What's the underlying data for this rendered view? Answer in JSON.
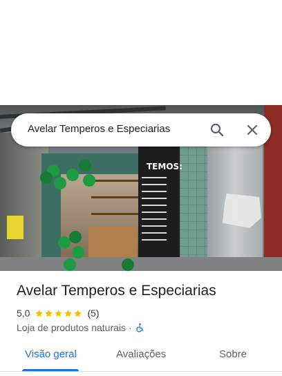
{
  "search": {
    "query": "Avelar Temperos e Especiarias",
    "search_icon": "search-icon",
    "close_icon": "close-icon"
  },
  "photo": {
    "sign_title": "TEMOS:"
  },
  "place": {
    "name": "Avelar Temperos e Especiarias",
    "rating": "5,0",
    "stars": 5,
    "review_count": "(5)",
    "category": "Loja de produtos naturais",
    "separator": "·",
    "accessibility_icon": "wheelchair-icon"
  },
  "tabs": [
    {
      "label": "Visão geral",
      "active": true
    },
    {
      "label": "Avaliações",
      "active": false
    },
    {
      "label": "Sobre",
      "active": false
    }
  ],
  "colors": {
    "accent": "#1a73e8",
    "star": "#fbbc04",
    "text_primary": "#202124",
    "text_secondary": "#5f6368"
  }
}
